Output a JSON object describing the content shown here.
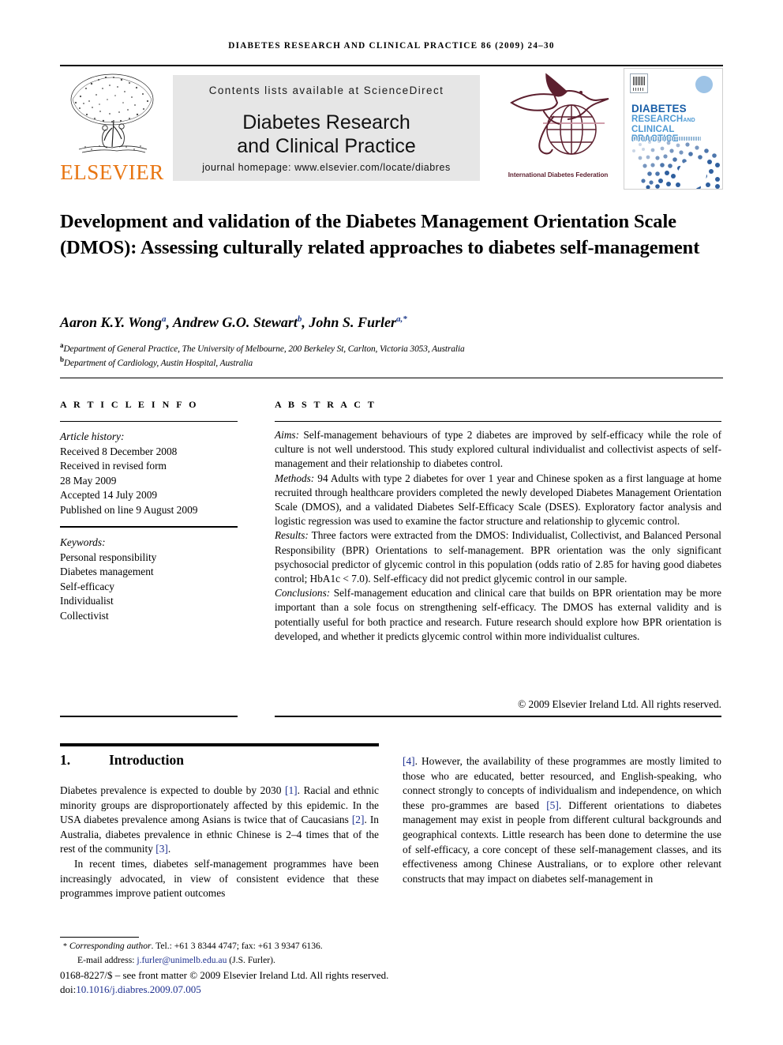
{
  "running_head": "Diabetes research and clinical practice 86 (2009) 24–30",
  "masthead": {
    "publisher": "ELSEVIER",
    "contents_line": "Contents lists available at ScienceDirect",
    "journal_title_line1": "Diabetes Research",
    "journal_title_line2": "and Clinical Practice",
    "homepage": "journal homepage: www.elsevier.com/locate/diabres",
    "idf_caption": "International Diabetes Federation",
    "cover": {
      "line1": "DIABETES",
      "line2": "RESEARCH",
      "line2_and": "AND",
      "line3": "CLINICAL PRACTICE"
    }
  },
  "article": {
    "title": "Development and validation of the Diabetes Management Orientation Scale (DMOS): Assessing culturally related approaches to diabetes self-management",
    "authors_html": "Aaron K.Y. Wong<sup>a</sup>, Andrew G.O. Stewart<sup>b</sup>, John S. Furler<sup>a,*</sup>",
    "affiliation_a": "Department of General Practice, The University of Melbourne, 200 Berkeley St, Carlton, Victoria 3053, Australia",
    "affiliation_b": "Department of Cardiology, Austin Hospital, Australia"
  },
  "info": {
    "heading": "A R T I C L E   I N F O",
    "history_label": "Article history:",
    "history": [
      "Received 8 December 2008",
      "Received in revised form",
      "28 May 2009",
      "Accepted 14 July 2009",
      "Published on line 9 August 2009"
    ],
    "keywords_label": "Keywords:",
    "keywords": [
      "Personal responsibility",
      "Diabetes management",
      "Self-efficacy",
      "Individualist",
      "Collectivist"
    ]
  },
  "abstract": {
    "heading": "A B S T R A C T",
    "aims_label": "Aims:",
    "aims_text": " Self-management behaviours of type 2 diabetes are improved by self-efficacy while the role of culture is not well understood. This study explored cultural individualist and collectivist aspects of self-management and their relationship to diabetes control.",
    "methods_label": "Methods:",
    "methods_text": " 94 Adults with type 2 diabetes for over 1 year and Chinese spoken as a first language at home recruited through healthcare providers completed the newly developed Diabetes Management Orientation Scale (DMOS), and a validated Diabetes Self-Efficacy Scale (DSES). Exploratory factor analysis and logistic regression was used to examine the factor structure and relationship to glycemic control.",
    "results_label": "Results:",
    "results_text": " Three factors were extracted from the DMOS: Individualist, Collectivist, and Balanced Personal Responsibility (BPR) Orientations to self-management. BPR orientation was the only significant psychosocial predictor of glycemic control in this population (odds ratio of 2.85 for having good diabetes control; HbA1c < 7.0). Self-efficacy did not predict glycemic control in our sample.",
    "conclusions_label": "Conclusions:",
    "conclusions_text": " Self-management education and clinical care that builds on BPR orientation may be more important than a sole focus on strengthening self-efficacy. The DMOS has external validity and is potentially useful for both practice and research. Future research should explore how BPR orientation is developed, and whether it predicts glycemic control within more individualist cultures.",
    "copyright": "© 2009 Elsevier Ireland Ltd. All rights reserved."
  },
  "body": {
    "section_number": "1.",
    "section_title": "Introduction",
    "left_p1_a": "Diabetes prevalence is expected to double by 2030 ",
    "left_p1_r1": "[1]",
    "left_p1_b": ". Racial and ethnic minority groups are disproportionately affected by this epidemic. In the USA diabetes prevalence among Asians is twice that of Caucasians ",
    "left_p1_r2": "[2]",
    "left_p1_c": ". In Australia, diabetes prevalence in ethnic Chinese is 2–4 times that of the rest of the community ",
    "left_p1_r3": "[3]",
    "left_p1_d": ".",
    "left_p2": "In recent times, diabetes self-management programmes have been increasingly advocated, in view of consistent evidence that these programmes improve patient outcomes",
    "right_r4": "[4]",
    "right_p1_a": ". However, the availability of these programmes are mostly limited to those who are educated, better resourced, and English-speaking, who connect strongly to concepts of individualism and independence, on which these pro-grammes are based ",
    "right_r5": "[5]",
    "right_p1_b": ". Different orientations to diabetes management may exist in people from different cultural backgrounds and geographical contexts. Little research has been done to determine the use of self-efficacy, a core concept of these self-management classes, and its effectiveness among Chinese Australians, or to explore other relevant constructs that may impact on diabetes self-management in"
  },
  "footer": {
    "star": "*",
    "corresponding_label": "Corresponding author",
    "corresponding_text": ". Tel.: +61 3 8344 4747; fax: +61 3 9347 6136.",
    "email_label": "E-mail address:",
    "email": "j.furler@unimelb.edu.au",
    "email_owner": "(J.S. Furler).",
    "issn_line": "0168-8227/$ – see front matter © 2009 Elsevier Ireland Ltd. All rights reserved.",
    "doi_label": "doi:",
    "doi": "10.1016/j.diabres.2009.07.005"
  },
  "colors": {
    "elsevier_orange": "#E87511",
    "idf_maroon": "#5c1f2e",
    "link_blue": "#1d2f8f",
    "cover_blue": "#1a5fa8",
    "sd_box_grey": "#e6e6e6"
  }
}
